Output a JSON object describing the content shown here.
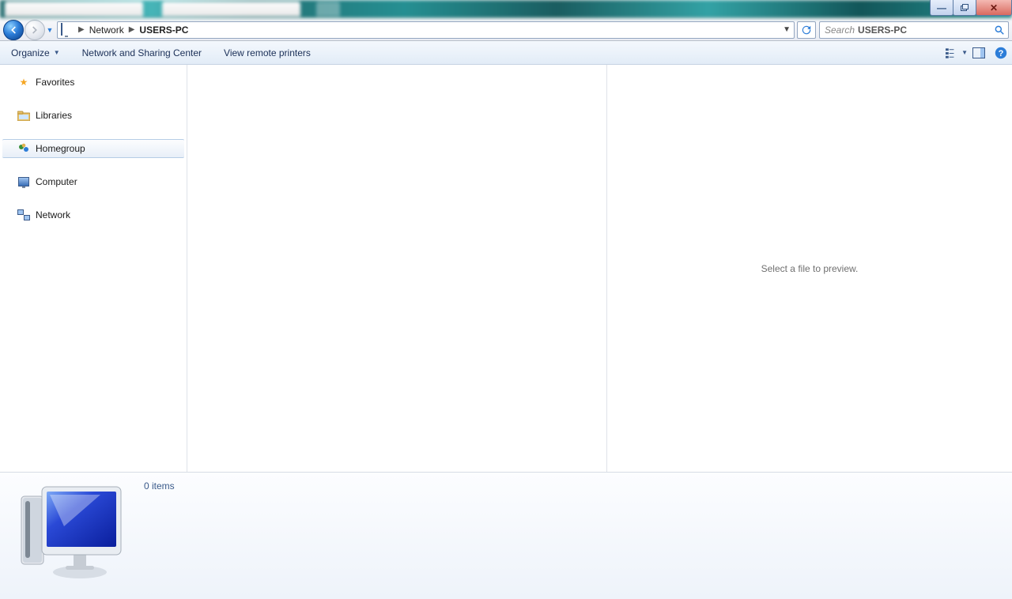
{
  "breadcrumb": {
    "root_label": "Network",
    "current_label": "USERS-PC"
  },
  "search": {
    "prefix": "Search",
    "current": "USERS-PC"
  },
  "commandbar": {
    "organize": "Organize",
    "nsc": "Network and Sharing Center",
    "vrp": "View remote printers"
  },
  "sidebar": {
    "favorites": "Favorites",
    "libraries": "Libraries",
    "homegroup": "Homegroup",
    "computer": "Computer",
    "network": "Network"
  },
  "preview": {
    "empty_message": "Select a file to preview."
  },
  "details": {
    "item_count": "0 items"
  }
}
